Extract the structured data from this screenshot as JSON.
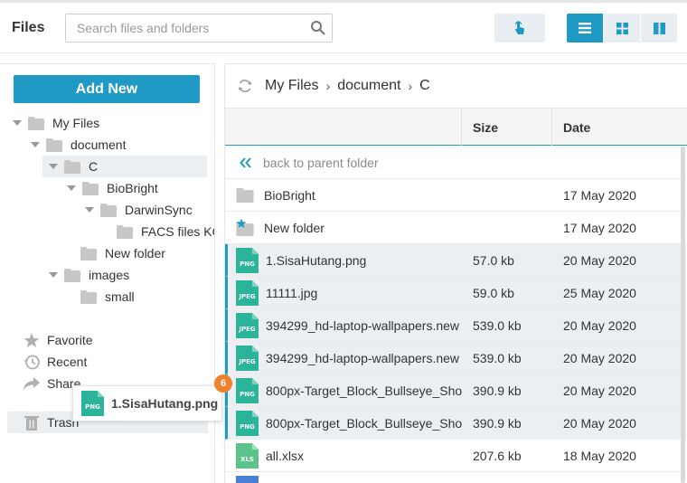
{
  "app": {
    "title": "Files"
  },
  "search": {
    "placeholder": "Search files and folders"
  },
  "colors": {
    "accent": "#1f9ac4",
    "png": "#2bb49a",
    "xlsx": "#5cc48a",
    "folder": "#c7c7c7",
    "badge": "#f0822b"
  },
  "toolbar": {
    "touch_icon": "touch-hand-icon",
    "views": [
      {
        "icon": "list-view-icon",
        "active": true
      },
      {
        "icon": "tiles-view-icon",
        "active": false
      },
      {
        "icon": "split-view-icon",
        "active": false
      }
    ]
  },
  "sidebar": {
    "add_new_label": "Add New",
    "tree": [
      {
        "label": "My Files"
      },
      {
        "label": "document"
      },
      {
        "label": "C"
      },
      {
        "label": "BioBright"
      },
      {
        "label": "DarwinSync"
      },
      {
        "label": "FACS files KO"
      },
      {
        "label": "New folder"
      },
      {
        "label": "images"
      },
      {
        "label": "small"
      }
    ],
    "nav": [
      {
        "label": "Favorite",
        "icon": "star-icon"
      },
      {
        "label": "Recent",
        "icon": "history-icon"
      },
      {
        "label": "Share",
        "icon": "share-icon"
      },
      {
        "label": "Trash",
        "icon": "trash-icon"
      }
    ]
  },
  "drag": {
    "label": "1.SisaHutang.png",
    "type": "PNG",
    "count": "6"
  },
  "breadcrumb": {
    "items": [
      "My Files",
      "document",
      "C"
    ]
  },
  "grid": {
    "headers": {
      "name": "",
      "size": "Size",
      "date": "Date"
    },
    "back_label": "back to parent folder",
    "rows": [
      {
        "name": "BioBright",
        "size": "",
        "date": "17 May 2020"
      },
      {
        "name": "New folder",
        "size": "",
        "date": "17 May 2020"
      },
      {
        "name": "1.SisaHutang.png",
        "type": "PNG",
        "size": "57.0 kb",
        "date": "20 May 2020"
      },
      {
        "name": "11111.jpg",
        "type": "JPEG",
        "size": "59.0 kb",
        "date": "25 May 2020"
      },
      {
        "name": "394299_hd-laptop-wallpapers.new",
        "type": "JPEG",
        "size": "539.0 kb",
        "date": "20 May 2020"
      },
      {
        "name": "394299_hd-laptop-wallpapers.new",
        "type": "JPEG",
        "size": "539.0 kb",
        "date": "20 May 2020"
      },
      {
        "name": "800px-Target_Block_Bullseye_Sho",
        "type": "PNG",
        "size": "390.9 kb",
        "date": "20 May 2020"
      },
      {
        "name": "800px-Target_Block_Bullseye_Sho",
        "type": "PNG",
        "size": "390.9 kb",
        "date": "20 May 2020"
      },
      {
        "name": "all.xlsx",
        "type": "XLS",
        "size": "207.6 kb",
        "date": "18 May 2020"
      }
    ]
  }
}
